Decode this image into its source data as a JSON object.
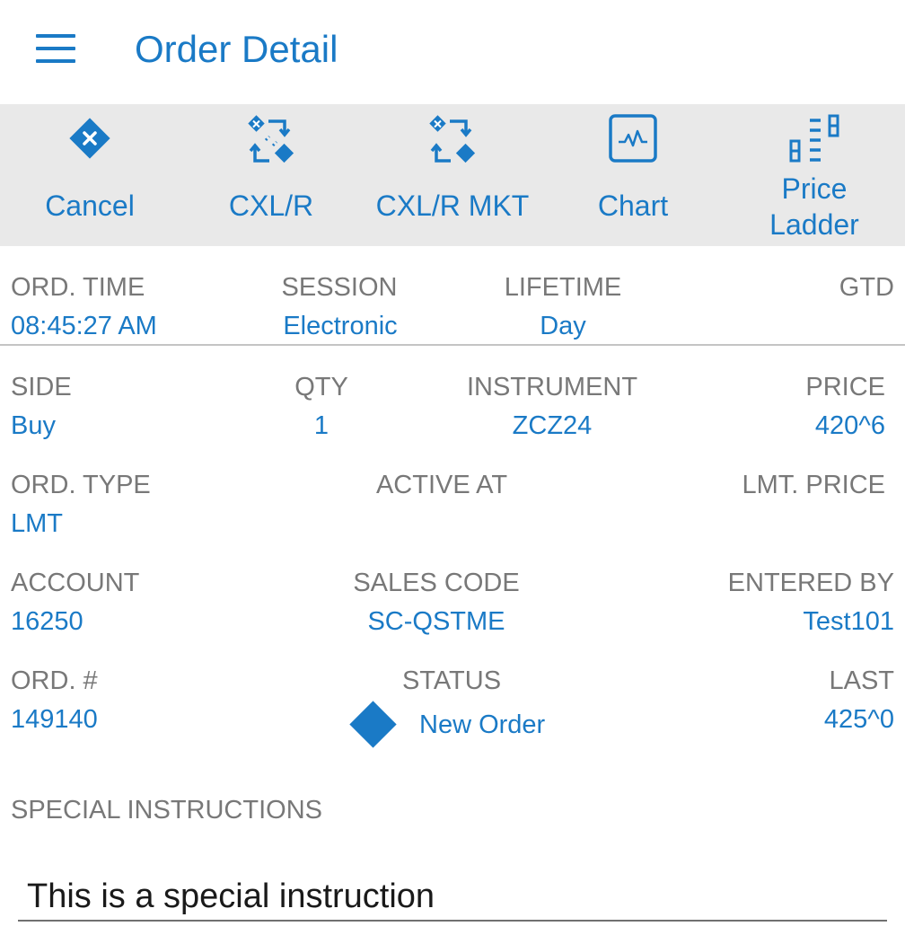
{
  "header": {
    "title": "Order Detail",
    "menu_icon": "hamburger-menu-icon"
  },
  "toolbar": {
    "items": [
      {
        "label": "Cancel",
        "icon": "cancel-diamond-icon"
      },
      {
        "label": "CXL/R",
        "icon": "cancel-replace-icon"
      },
      {
        "label": "CXL/R MKT",
        "icon": "cancel-replace-market-icon"
      },
      {
        "label": "Chart",
        "icon": "chart-icon"
      },
      {
        "label_line1": "Price",
        "label_line2": "Ladder",
        "icon": "price-ladder-icon"
      }
    ]
  },
  "order": {
    "ord_time": {
      "label": "ORD. TIME",
      "value": "08:45:27 AM"
    },
    "session": {
      "label": "SESSION",
      "value": "Electronic"
    },
    "lifetime": {
      "label": "LIFETIME",
      "value": "Day"
    },
    "gtd": {
      "label": "GTD",
      "value": ""
    },
    "side": {
      "label": "SIDE",
      "value": "Buy"
    },
    "qty": {
      "label": "QTY",
      "value": "1"
    },
    "instrument": {
      "label": "INSTRUMENT",
      "value": "ZCZ24"
    },
    "price": {
      "label": "PRICE",
      "value": "420^6"
    },
    "ord_type": {
      "label": "ORD. TYPE",
      "value": "LMT"
    },
    "active_at": {
      "label": "ACTIVE AT",
      "value": ""
    },
    "lmt_price": {
      "label": "LMT. PRICE",
      "value": ""
    },
    "account": {
      "label": "ACCOUNT",
      "value": "16250"
    },
    "sales_code": {
      "label": "SALES CODE",
      "value": "SC-QSTME"
    },
    "entered_by": {
      "label": "ENTERED BY",
      "value": "Test101"
    },
    "ord_num": {
      "label": "ORD. #",
      "value": "149140"
    },
    "status": {
      "label": "STATUS",
      "value": "New Order",
      "icon": "status-diamond-icon"
    },
    "last": {
      "label": "LAST",
      "value": "425^0"
    }
  },
  "special_instructions": {
    "label": "SPECIAL INSTRUCTIONS",
    "value": "This is a special instruction"
  },
  "colors": {
    "accent": "#1a7ac6",
    "label_gray": "#787878",
    "toolbar_bg": "#e9e9e9"
  }
}
